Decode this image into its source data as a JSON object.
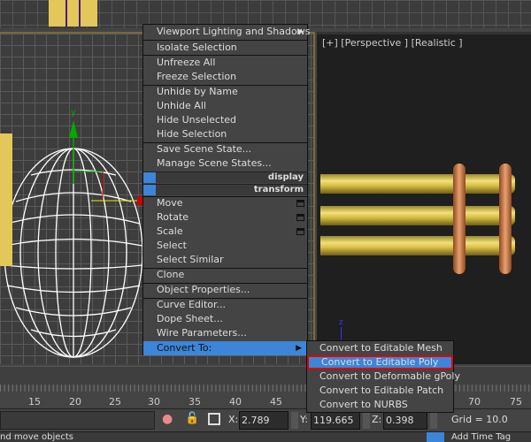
{
  "viewport": {
    "label": "[+] [Perspective ] [Realistic ]",
    "gizmo_axis_y": "y",
    "gizmo_axis_z": "z"
  },
  "context_menu": {
    "items": [
      "Viewport Lighting and Shadows",
      "Isolate Selection",
      "Unfreeze All",
      "Freeze Selection",
      "Unhide by Name",
      "Unhide All",
      "Hide Unselected",
      "Hide Selection",
      "Save Scene State...",
      "Manage Scene States...",
      "Move",
      "Rotate",
      "Scale",
      "Select",
      "Select Similar",
      "Clone",
      "Object Properties...",
      "Curve Editor...",
      "Dope Sheet...",
      "Wire Parameters...",
      "Convert To:"
    ],
    "quad_display": "display",
    "quad_transform": "transform"
  },
  "submenu": {
    "items": [
      "Convert to Editable Mesh",
      "Convert to Editable Poly",
      "Convert to Deformable gPoly",
      "Convert to Editable Patch",
      "Convert to NURBS"
    ],
    "selected": "Convert to Editable Poly"
  },
  "timeline": {
    "ticks": [
      "15",
      "20",
      "25",
      "30",
      "35",
      "40",
      "45",
      "70",
      "75"
    ]
  },
  "status": {
    "x_label": "X:",
    "x_value": "2.789",
    "y_label": "Y:",
    "y_value": "119.665",
    "z_label": "Z:",
    "z_value": "0.398",
    "grid": "Grid = 10.0",
    "prompt": "nd move objects",
    "add_time_tag": "Add Time Tag"
  },
  "colors": {
    "accent": "#3d85d8",
    "highlight_border": "#e00000",
    "menu_bg": "#444444"
  }
}
